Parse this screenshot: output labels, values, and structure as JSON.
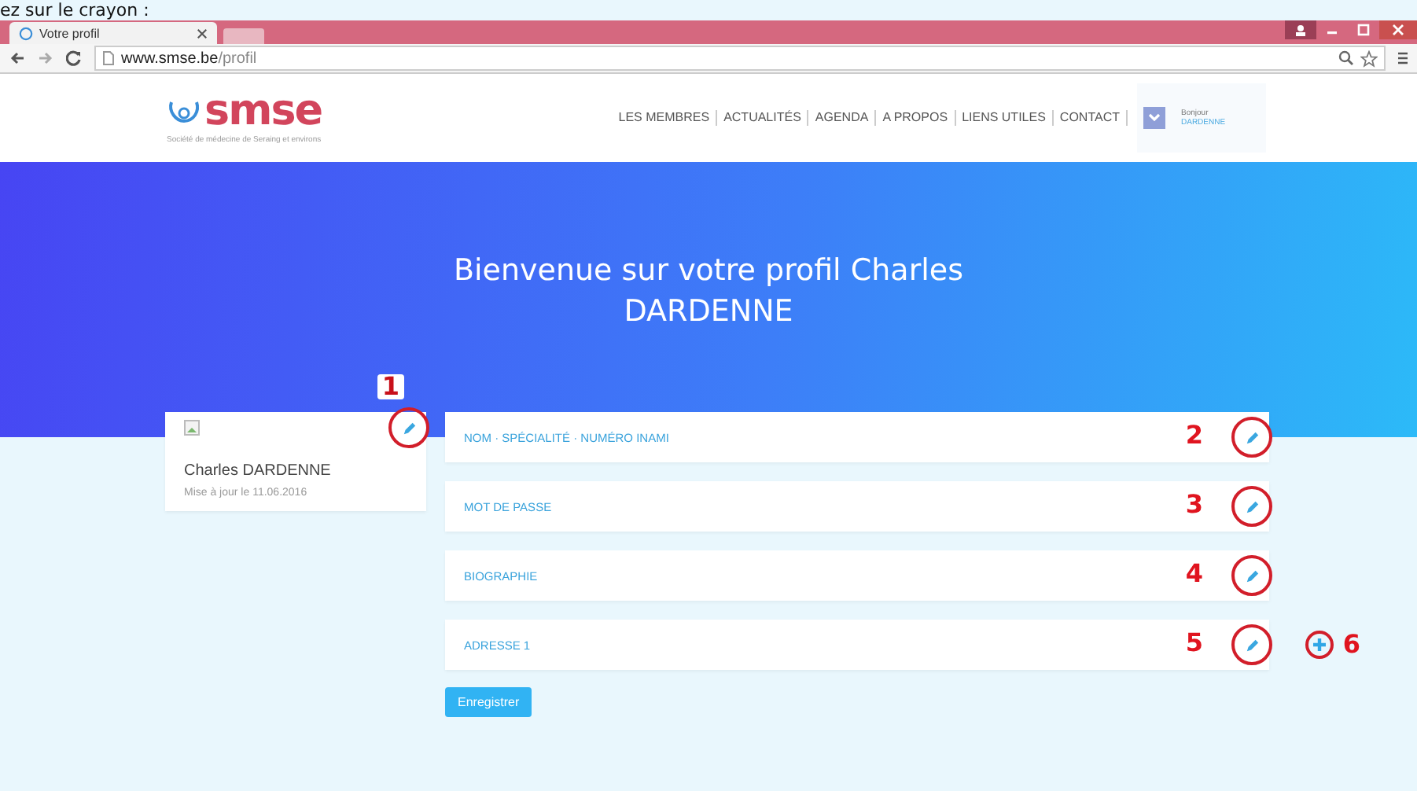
{
  "caption": "ez sur le crayon :",
  "browser": {
    "tab_title": "Votre profil",
    "url_host": "www.smse.be",
    "url_path": "/profil"
  },
  "site": {
    "logo": "smse",
    "tagline": "Société de médecine de Seraing et environs",
    "nav": [
      "LES MEMBRES",
      "ACTUALITÉS",
      "AGENDA",
      "A PROPOS",
      "LIENS UTILES",
      "CONTACT"
    ],
    "greeting": "Bonjour",
    "user": "DARDENNE"
  },
  "hero": {
    "title": "Bienvenue sur votre profil Charles DARDENNE"
  },
  "profile": {
    "name": "Charles DARDENNE",
    "updated": "Mise à jour le 11.06.2016",
    "annotation": "1"
  },
  "sections": [
    {
      "label": "NOM · SPÉCIALITÉ · NUMÉRO INAMI",
      "annotation": "2",
      "add": false
    },
    {
      "label": "MOT DE PASSE",
      "annotation": "3",
      "add": false
    },
    {
      "label": "BIOGRAPHIE",
      "annotation": "4",
      "add": false
    },
    {
      "label": "ADRESSE 1",
      "annotation": "5",
      "add": true,
      "add_annotation": "6"
    }
  ],
  "save_button": "Enregistrer"
}
